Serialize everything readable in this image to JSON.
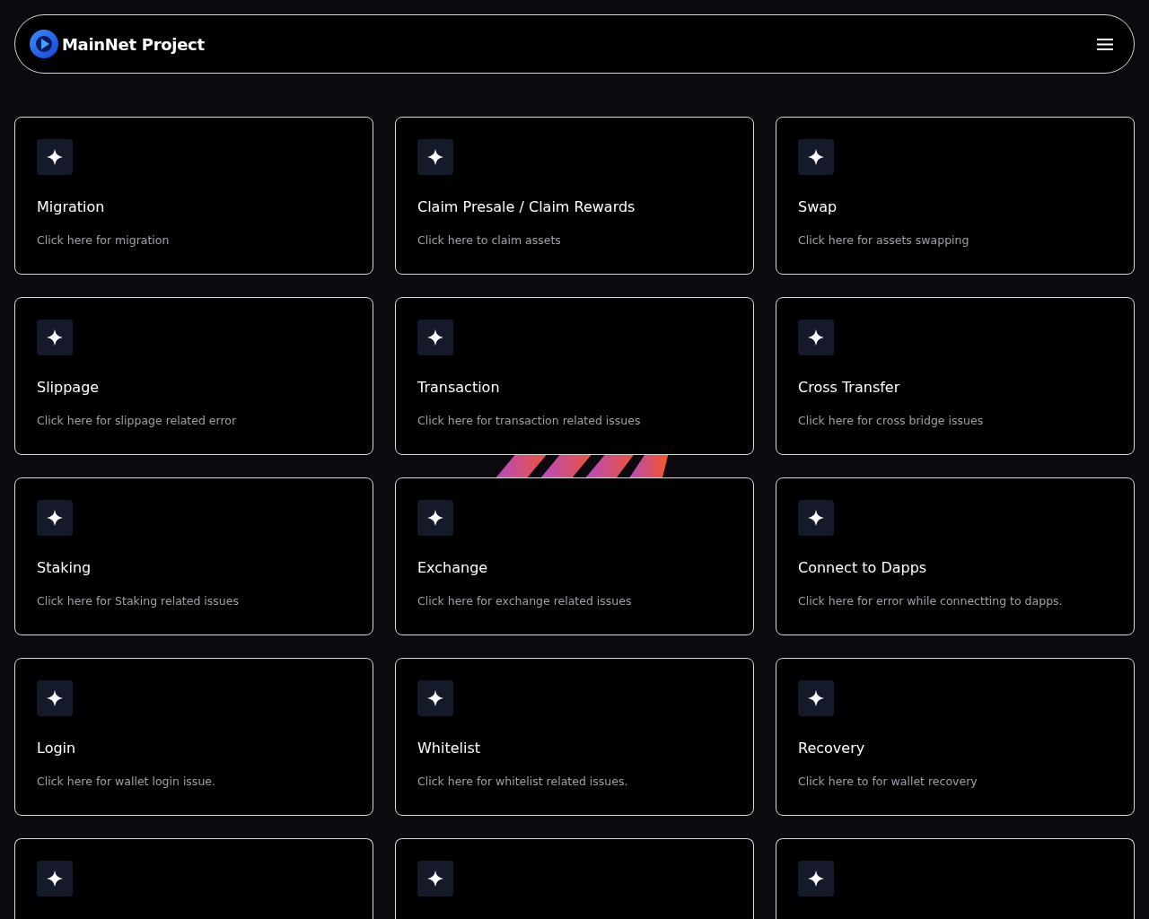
{
  "header": {
    "brand": "MainNet Project"
  },
  "cards": [
    {
      "title": "Migration",
      "description": "Click here for migration"
    },
    {
      "title": "Claim Presale / Claim Rewards",
      "description": "Click here to claim assets"
    },
    {
      "title": "Swap",
      "description": "Click here for assets swapping"
    },
    {
      "title": "Slippage",
      "description": "Click here for slippage related error"
    },
    {
      "title": "Transaction",
      "description": "Click here for transaction related issues"
    },
    {
      "title": "Cross Transfer",
      "description": "Click here for cross bridge issues"
    },
    {
      "title": "Staking",
      "description": "Click here for Staking related issues"
    },
    {
      "title": "Exchange",
      "description": "Click here for exchange related issues"
    },
    {
      "title": "Connect to Dapps",
      "description": "Click here for error while connectting to dapps."
    },
    {
      "title": "Login",
      "description": "Click here for wallet login issue."
    },
    {
      "title": "Whitelist",
      "description": "Click here for whitelist related issues."
    },
    {
      "title": "Recovery",
      "description": "Click here to for wallet recovery"
    },
    {
      "kind": "cut_off"
    },
    {
      "kind": "cut_off"
    },
    {
      "kind": "cut_off"
    }
  ]
}
